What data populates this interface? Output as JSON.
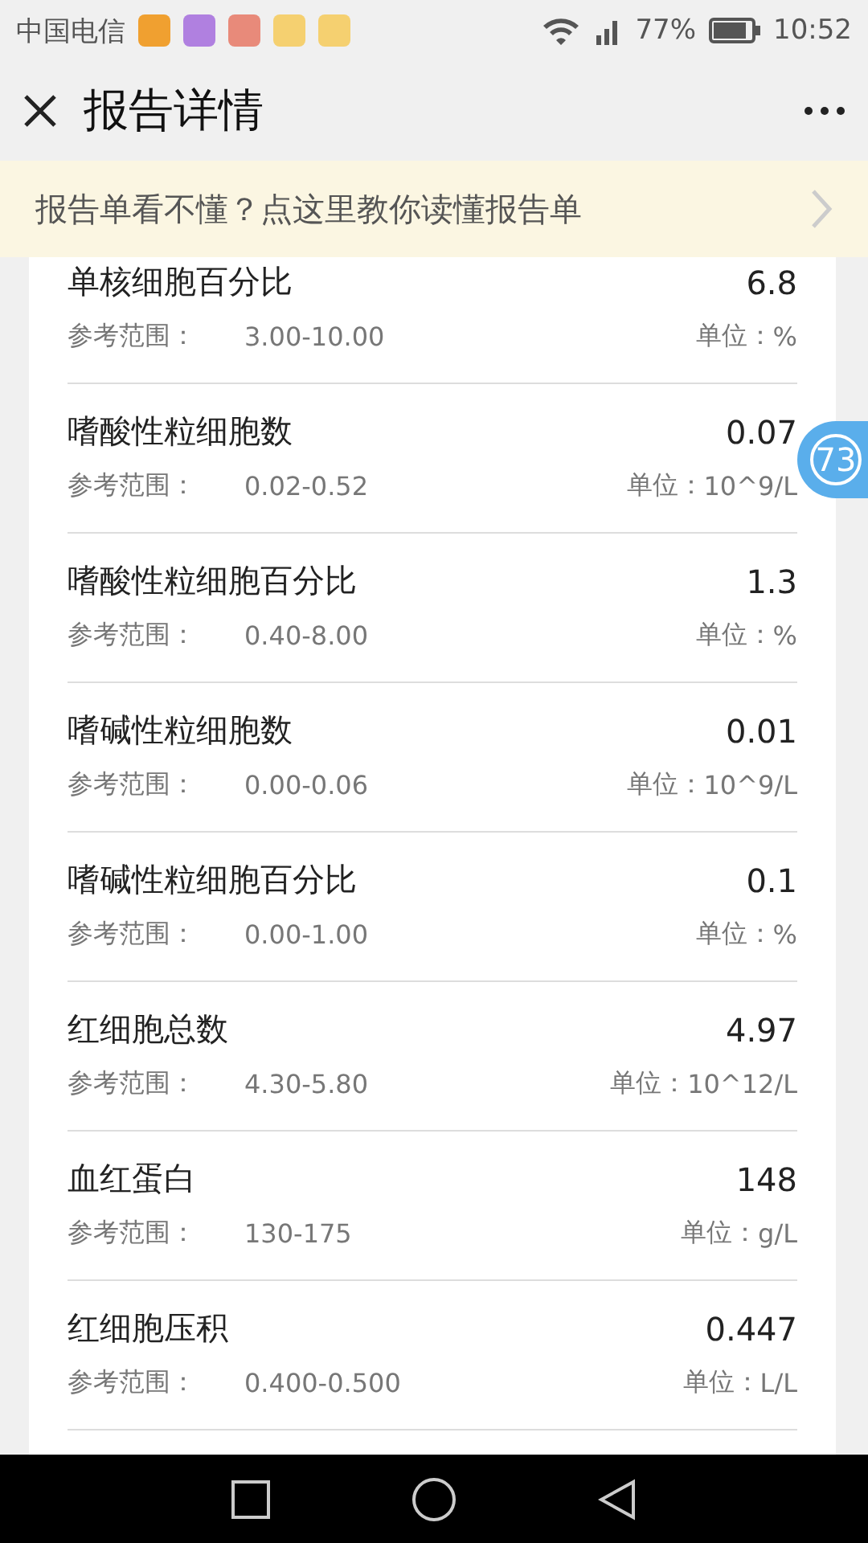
{
  "status_bar": {
    "carrier": "中国电信",
    "battery": "77%",
    "time": "10:52"
  },
  "header": {
    "title": "报告详情"
  },
  "banner": {
    "text": "报告单看不懂？点这里教你读懂报告单"
  },
  "results": [
    {
      "name": "单核细胞百分比",
      "value": "6.8",
      "range_label": "参考范围：",
      "range": "3.00-10.00",
      "unit_label": "单位：",
      "unit": "%"
    },
    {
      "name": "嗜酸性粒细胞数",
      "value": "0.07",
      "range_label": "参考范围：",
      "range": "0.02-0.52",
      "unit_label": "单位：",
      "unit": "10^9/L"
    },
    {
      "name": "嗜酸性粒细胞百分比",
      "value": "1.3",
      "range_label": "参考范围：",
      "range": "0.40-8.00",
      "unit_label": "单位：",
      "unit": "%"
    },
    {
      "name": "嗜碱性粒细胞数",
      "value": "0.01",
      "range_label": "参考范围：",
      "range": "0.00-0.06",
      "unit_label": "单位：",
      "unit": "10^9/L"
    },
    {
      "name": "嗜碱性粒细胞百分比",
      "value": "0.1",
      "range_label": "参考范围：",
      "range": "0.00-1.00",
      "unit_label": "单位：",
      "unit": "%"
    },
    {
      "name": "红细胞总数",
      "value": "4.97",
      "range_label": "参考范围：",
      "range": "4.30-5.80",
      "unit_label": "单位：",
      "unit": "10^12/L"
    },
    {
      "name": "血红蛋白",
      "value": "148",
      "range_label": "参考范围：",
      "range": "130-175",
      "unit_label": "单位：",
      "unit": "g/L"
    },
    {
      "name": "红细胞压积",
      "value": "0.447",
      "range_label": "参考范围：",
      "range": "0.400-0.500",
      "unit_label": "单位：",
      "unit": "L/L"
    }
  ],
  "floating_badge": "73"
}
